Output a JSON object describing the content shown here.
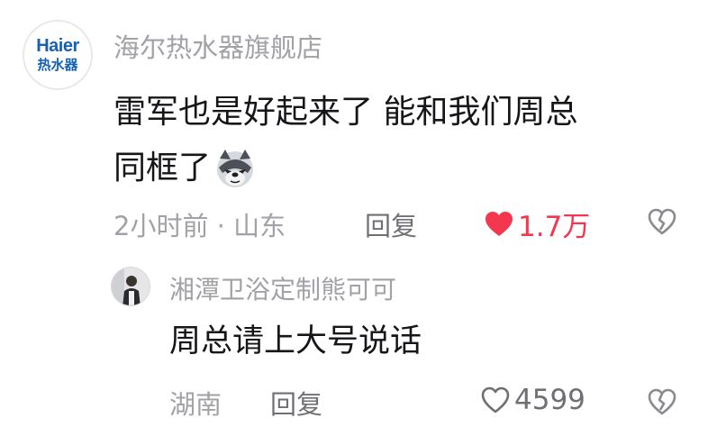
{
  "comment": {
    "avatar": {
      "brand": "Haier",
      "sub": "热水器"
    },
    "username": "海尔热水器旗舰店",
    "text_line1": "雷军也是好起来了 能和我们周总",
    "text_line2": "同框了",
    "emoji": "wolf-face-icon",
    "time_location": "2小时前 · 山东",
    "reply_label": "回复",
    "likes": "1.7万",
    "liked": true,
    "like_color": "#f2374e"
  },
  "reply": {
    "username": "湘潭卫浴定制熊可可",
    "text": "周总请上大号说话",
    "location": "湖南",
    "reply_label": "回复",
    "likes": "4599",
    "liked": false
  }
}
